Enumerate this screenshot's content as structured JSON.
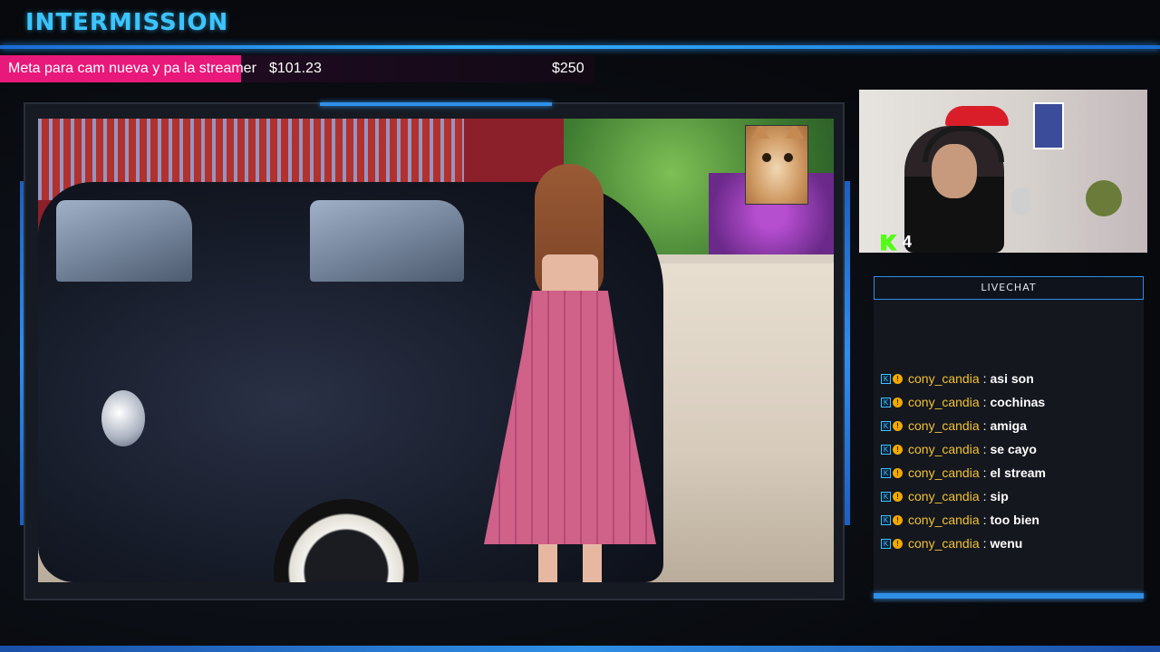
{
  "header": {
    "title": "INTERMISSION"
  },
  "goal": {
    "label": "Meta para cam nueva y pa la streamer",
    "current": "$101.23",
    "target": "$250",
    "progress_fraction": 0.405
  },
  "webcam": {
    "viewer_count": "4"
  },
  "chat": {
    "header": "LIVECHAT",
    "separator": ":",
    "messages": [
      {
        "user": "cony_candia",
        "text": "asi son"
      },
      {
        "user": "cony_candia",
        "text": "cochinas"
      },
      {
        "user": "cony_candia",
        "text": "amiga"
      },
      {
        "user": "cony_candia",
        "text": "se cayo"
      },
      {
        "user": "cony_candia",
        "text": "el stream"
      },
      {
        "user": "cony_candia",
        "text": "sip"
      },
      {
        "user": "cony_candia",
        "text": "too bien"
      },
      {
        "user": "cony_candia",
        "text": "wenu"
      }
    ]
  },
  "colors": {
    "accent": "#2f8fe6",
    "title": "#3cc4ff",
    "goal_fill": "#e8197a",
    "username": "#f2c232",
    "kick_green": "#53fc18"
  },
  "icons": [
    "kick-logo-icon",
    "kick-badge-icon",
    "coin-badge-icon"
  ]
}
